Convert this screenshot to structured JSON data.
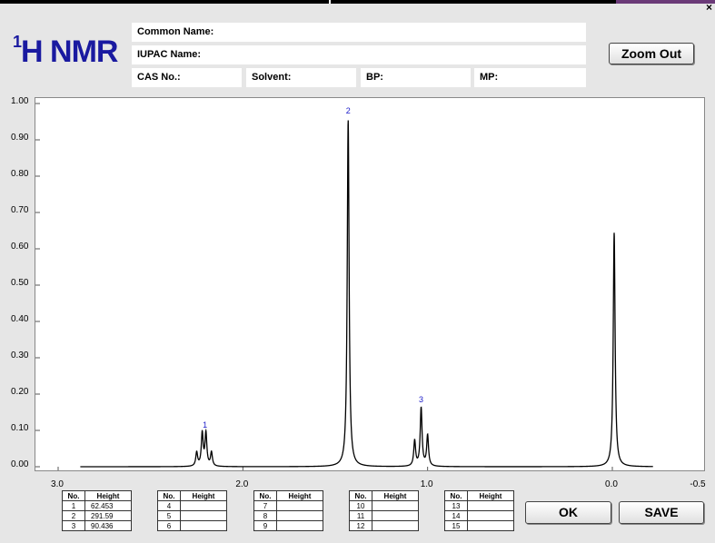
{
  "window": {
    "close_label": "×"
  },
  "header": {
    "title_sup": "1",
    "title_main": "H NMR",
    "common_name_label": "Common Name:",
    "iupac_name_label": "IUPAC Name:",
    "cas_label": "CAS No.:",
    "solvent_label": "Solvent:",
    "bp_label": "BP:",
    "mp_label": "MP:"
  },
  "buttons": {
    "zoom_out": "Zoom Out",
    "ok": "OK",
    "save": "SAVE"
  },
  "colors": {
    "title": "#1a1aa0",
    "peak_label": "#1a1ac8",
    "background": "#e6e6e6"
  },
  "chart_data": {
    "type": "line",
    "title": "",
    "xlabel": "",
    "ylabel": "",
    "x_reversed": true,
    "xlim": [
      3.1,
      -0.5
    ],
    "ylim": [
      0,
      1.0
    ],
    "yticks": [
      "0.00",
      "0.10",
      "0.20",
      "0.30",
      "0.40",
      "0.50",
      "0.60",
      "0.70",
      "0.80",
      "0.90",
      "1.00"
    ],
    "xticks": [
      "3.0",
      "2.0",
      "1.0",
      "0.0",
      "-0.5"
    ],
    "peaks": [
      {
        "center": 2.25,
        "height": 0.038,
        "width": 0.006
      },
      {
        "center": 2.22,
        "height": 0.09,
        "width": 0.006
      },
      {
        "center": 2.2,
        "height": 0.09,
        "width": 0.006
      },
      {
        "center": 2.17,
        "height": 0.038,
        "width": 0.006
      },
      {
        "center": 1.43,
        "height": 0.955,
        "width": 0.006
      },
      {
        "center": 1.07,
        "height": 0.07,
        "width": 0.006
      },
      {
        "center": 1.035,
        "height": 0.16,
        "width": 0.006
      },
      {
        "center": 1.0,
        "height": 0.085,
        "width": 0.006
      },
      {
        "center": -0.01,
        "height": 0.645,
        "width": 0.006
      }
    ],
    "peak_labels": [
      {
        "label": "1",
        "x": 2.205,
        "y": 0.1
      },
      {
        "label": "2",
        "x": 1.43,
        "y": 0.965
      },
      {
        "label": "3",
        "x": 1.035,
        "y": 0.17
      }
    ]
  },
  "peak_tables": [
    {
      "header_no": "No.",
      "header_height": "Height",
      "rows": [
        {
          "no": "1",
          "height": "62.453"
        },
        {
          "no": "2",
          "height": "291.59"
        },
        {
          "no": "3",
          "height": "90.436"
        }
      ]
    },
    {
      "header_no": "No.",
      "header_height": "Height",
      "rows": [
        {
          "no": "4",
          "height": ""
        },
        {
          "no": "5",
          "height": ""
        },
        {
          "no": "6",
          "height": ""
        }
      ]
    },
    {
      "header_no": "No.",
      "header_height": "Height",
      "rows": [
        {
          "no": "7",
          "height": ""
        },
        {
          "no": "8",
          "height": ""
        },
        {
          "no": "9",
          "height": ""
        }
      ]
    },
    {
      "header_no": "No.",
      "header_height": "Height",
      "rows": [
        {
          "no": "10",
          "height": ""
        },
        {
          "no": "11",
          "height": ""
        },
        {
          "no": "12",
          "height": ""
        }
      ]
    },
    {
      "header_no": "No.",
      "header_height": "Height",
      "rows": [
        {
          "no": "13",
          "height": ""
        },
        {
          "no": "14",
          "height": ""
        },
        {
          "no": "15",
          "height": ""
        }
      ]
    }
  ]
}
